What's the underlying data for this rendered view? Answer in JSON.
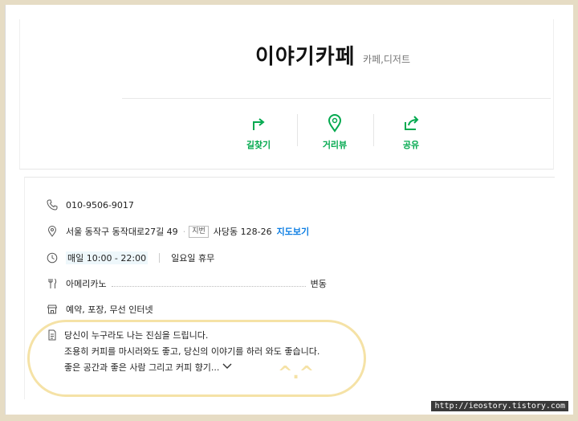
{
  "place": {
    "name": "이야기카페",
    "category": "카페,디저트"
  },
  "actions": [
    {
      "label": "길찾기",
      "icon": "directions-icon"
    },
    {
      "label": "거리뷰",
      "icon": "street-view-pin-icon"
    },
    {
      "label": "공유",
      "icon": "share-icon"
    }
  ],
  "info": {
    "phone": "010-9506-9017",
    "address": "서울 동작구 동작대로27길 49",
    "jibun_tag": "지번",
    "jibun": "사당동 128-26",
    "map_link": "지도보기",
    "hours": "매일 10:00 - 22:00",
    "closed": "일요일 휴무",
    "menu_item": "아메리카노",
    "menu_price": "변동",
    "services": "예약, 포장, 무선 인터넷",
    "description": [
      "당신이 누구라도 나는 진심을 드립니다.",
      "조용히 커피를 마시러와도 좋고, 당신의 이야기를 하러 와도 좋습니다.",
      "좋은 공간과 좋은 사람 그리고 커피 향기..."
    ]
  },
  "annotation": "^.^",
  "watermark": "http://ieostory.tistory.com",
  "colors": {
    "accent": "#03a94f",
    "link": "#0b7de3",
    "highlight": "#f5e2a6",
    "frame": "#e6dcc4"
  }
}
